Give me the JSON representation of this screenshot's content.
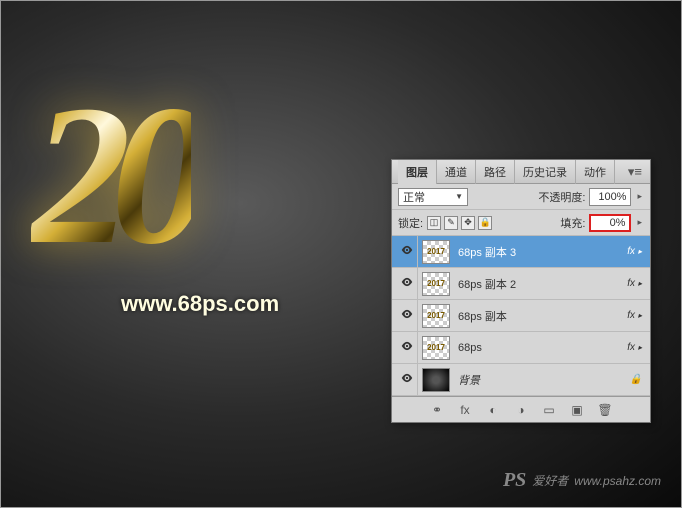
{
  "canvas": {
    "main_text": "20",
    "watermark": "www.68ps.com",
    "watermark_sub_prefix": "PS",
    "watermark_sub_text": "爱好者",
    "watermark_url": "www.psahz.com"
  },
  "panel": {
    "tabs": [
      "图层",
      "通道",
      "路径",
      "历史记录",
      "动作"
    ],
    "active_tab": 0,
    "blend_mode": "正常",
    "opacity_label": "不透明度:",
    "opacity_value": "100%",
    "lock_label": "锁定:",
    "fill_label": "填充:",
    "fill_value": "0%"
  },
  "layers": [
    {
      "name": "68ps 副本 3",
      "visible": true,
      "fx": true,
      "selected": true,
      "thumb_text": "2017",
      "checker": true
    },
    {
      "name": "68ps 副本 2",
      "visible": true,
      "fx": true,
      "selected": false,
      "thumb_text": "2017",
      "checker": true
    },
    {
      "name": "68ps 副本",
      "visible": true,
      "fx": true,
      "selected": false,
      "thumb_text": "2017",
      "checker": true
    },
    {
      "name": "68ps",
      "visible": true,
      "fx": true,
      "selected": false,
      "thumb_text": "2017",
      "checker": true
    },
    {
      "name": "背景",
      "visible": true,
      "fx": false,
      "selected": false,
      "thumb_text": "",
      "checker": false
    }
  ],
  "fx_label": "fx"
}
